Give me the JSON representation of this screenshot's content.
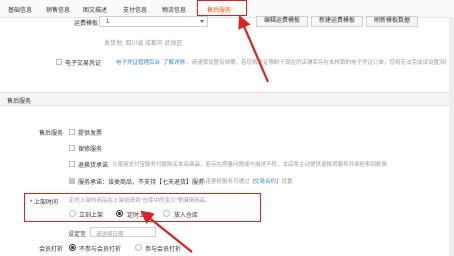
{
  "tabs": [
    "基础信息",
    "销售信息",
    "图文描述",
    "支付信息",
    "物流信息",
    "售后服务"
  ],
  "logistics": {
    "template_label": "运费模板 *",
    "template_value": "1",
    "edit_button": "编辑运费模板",
    "new_button": "新建运费模板",
    "refresh_button": "刷新模板数据",
    "ship_from": "发货地: 四川省 成都市 武侯区"
  },
  "e_voucher": {
    "label": "电子交易凭证",
    "link": "电子凭证管理后台",
    "learn_more": "了解详情",
    "desc": "，请谨慎设置有效期，若您将凭证限制于现在的店铺库存在未核销的电子凭证订单，您将无法完成该设置流程！"
  },
  "section_title": "售后服务",
  "after_sales": {
    "label": "售后服务",
    "invoice": "提供发票",
    "warranty": "保修服务",
    "return_promise": "退换货承诺",
    "return_desc": "凡使用支付宝服务付款购买本店商品，若存在质量问题或与描述不符，本店将主动提供退换货服务并承担来回邮费",
    "service_promise": "服务承诺：该类商品，不支持【七天退货】服务",
    "service_desc": "承诺更好服务可通过【",
    "trade_contract": "交易合约",
    "service_desc_end": "】设置"
  },
  "listing": {
    "label": "* 上架时间",
    "desc": "定时上架的商品在上架前请到\"仓库中的宝贝\"里编辑商品。",
    "immediate": "立刻上架",
    "scheduled": "定时上架",
    "warehouse": "放入仓库"
  },
  "schedule": {
    "label": "设定至",
    "placeholder": "请选择日期"
  },
  "discount": {
    "label": "会员打折",
    "no": "不参与会员打折",
    "yes": "参与会员打折"
  }
}
